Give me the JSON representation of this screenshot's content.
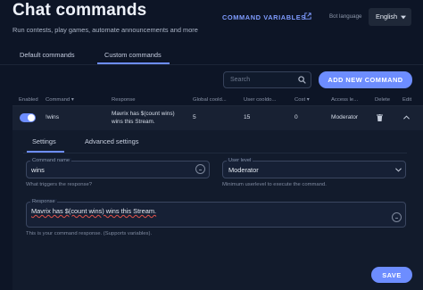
{
  "header": {
    "title": "Chat commands",
    "subtitle": "Run contests, play games, automate announcements and more",
    "command_variables": "COMMAND VARIABLES",
    "bot_language_label": "Bot language",
    "bot_language_value": "English"
  },
  "tabs": [
    {
      "label": "Default commands",
      "active": false
    },
    {
      "label": "Custom commands",
      "active": true
    }
  ],
  "toolbar": {
    "search_placeholder": "Search",
    "add_button": "ADD NEW COMMAND"
  },
  "table": {
    "columns": [
      "Enabled",
      "Command",
      "Response",
      "Global coold...",
      "User cooldo...",
      "Cost",
      "Access le...",
      "Delete",
      "Edit"
    ],
    "sort_glyph": "▾",
    "rows": [
      {
        "enabled": true,
        "command": "!wins",
        "response": "Mavrix has $(count wins) wins this Stream.",
        "global_cooldown": "5",
        "user_cooldown": "15",
        "cost": "0",
        "access_level": "Moderator"
      }
    ]
  },
  "editor": {
    "tabs": [
      {
        "label": "Settings",
        "active": true
      },
      {
        "label": "Advanced settings",
        "active": false
      }
    ],
    "command_name": {
      "label": "Command name",
      "value": "wins",
      "helper": "What triggers the response?"
    },
    "user_level": {
      "label": "User level",
      "value": "Moderator",
      "helper": "Minimum userlevel to execute the command."
    },
    "response": {
      "label": "Response",
      "value": "Mavrix has $(count wins) wins this Stream.",
      "helper": "This is your command response. (Supports variables)."
    },
    "save_button": "SAVE"
  },
  "colors": {
    "accent": "#6d8dff",
    "background": "#0d1526",
    "row": "#182133"
  }
}
